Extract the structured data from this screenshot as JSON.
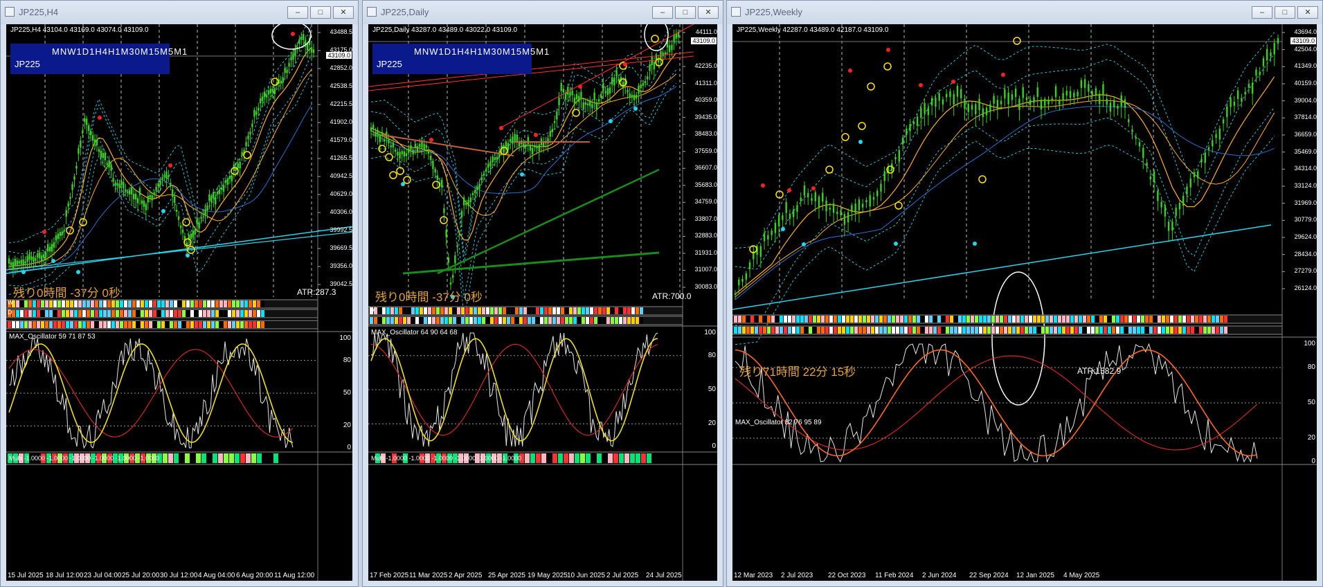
{
  "windows": [
    {
      "title": "JP225,H4",
      "symbol_line": "JP225,H4  43104.0 43169.0 43074.0 43109.0",
      "tf_labels": "MNW1D1H4H1M30M15M5M1",
      "tf_symbol": "JP225",
      "countdown": "残り0時間 -37分 0秒",
      "atr": "ATR:287.3",
      "price_current": "43109.0",
      "price_levels": [
        "43488.5",
        "43175.0",
        "42852.0",
        "42538.5",
        "42215.5",
        "41902.0",
        "41579.0",
        "41265.5",
        "40942.5",
        "40629.0",
        "40306.0",
        "39992.5",
        "39669.5",
        "39356.0",
        "39042.5"
      ],
      "strip_letters": [
        "W",
        "D"
      ],
      "osc_label": "MAX_Oscillator 59 71 87 53",
      "osc_scale": [
        "100",
        "80",
        "50",
        "20",
        "0"
      ],
      "multi_text": "Multi -1.0000 -1.0000 -1.0000 -1.0000 -1.0000 -1.0000",
      "dates": [
        "15 Jul 2025",
        "18 Jul 12:00",
        "23 Jul 04:00",
        "25 Jul 20:00",
        "30 Jul 12:00",
        "4 Aug 04:00",
        "6 Aug 20:00",
        "11 Aug 12:00"
      ]
    },
    {
      "title": "JP225,Daily",
      "symbol_line": "JP225,Daily  43287.0 43489.0 43022.0 43109.0",
      "tf_labels": "MNW1D1H4H1M30M15M5M1",
      "tf_symbol": "JP225",
      "countdown": "残り0時間 -37分 0秒",
      "atr": "ATR:700.0",
      "price_current": "43109.0",
      "price_levels": [
        "44111.0",
        "43109.0",
        "42235.0",
        "41311.0",
        "40359.0",
        "39435.0",
        "38483.0",
        "37559.0",
        "36607.0",
        "35683.0",
        "34759.0",
        "33807.0",
        "32883.0",
        "31931.0",
        "31007.0",
        "30083.0"
      ],
      "strip_letters": [
        "W"
      ],
      "osc_label": "MAX_Oscillator 64 90 64 68",
      "osc_scale": [
        "100",
        "80",
        "50",
        "20",
        "0"
      ],
      "multi_text": "Multi -1.0000 -1.0000 -1.0000 -1.0000 -1.0000 -1.0000",
      "dates": [
        "17 Feb 2025",
        "11 Mar 2025",
        "2 Apr 2025",
        "25 Apr 2025",
        "19 May 2025",
        "10 Jun 2025",
        "2 Jul 2025",
        "24 Jul 2025"
      ]
    },
    {
      "title": "JP225,Weekly",
      "symbol_line": "JP225,Weekly  42287.0 43489.0 42187.0 43109.0",
      "countdown": "残り71時間 22分 15秒",
      "atr": "ATR:1582.9",
      "price_current": "43109.0",
      "price_levels": [
        "43694.0",
        "42504.0",
        "41349.0",
        "40159.0",
        "39004.0",
        "37814.0",
        "36659.0",
        "35469.0",
        "34314.0",
        "33124.0",
        "31969.0",
        "30779.0",
        "29624.0",
        "28434.0",
        "27279.0",
        "26124.0"
      ],
      "osc_label": "MAX_Oscillator 82 76 95 89",
      "osc_scale": [
        "100",
        "80",
        "50",
        "20",
        "0"
      ],
      "dates": [
        "12 Mar 2023",
        "2 Jul 2023",
        "22 Oct 2023",
        "11 Feb 2024",
        "2 Jun 2024",
        "22 Sep 2024",
        "12 Jan 2025",
        "4 May 2025"
      ]
    }
  ],
  "colors": {
    "bg": "#000000",
    "candle": "#39d21f",
    "band": "#29c5d8",
    "ma_orange": "#ffb020",
    "ma_blue": "#2e6fd0",
    "trend_cyan": "#28d6ea",
    "osc_white": "#e6e6e6",
    "osc_red": "#d42a20",
    "osc_yellow": "#f0e020",
    "osc_cyan": "#30d0e8",
    "dot_red": "#ff2020",
    "dot_cyan": "#20d8f0",
    "marker_yellow": "#ffe400",
    "tf_box": "#0a1a8c",
    "countdown": "#e0a23a"
  }
}
